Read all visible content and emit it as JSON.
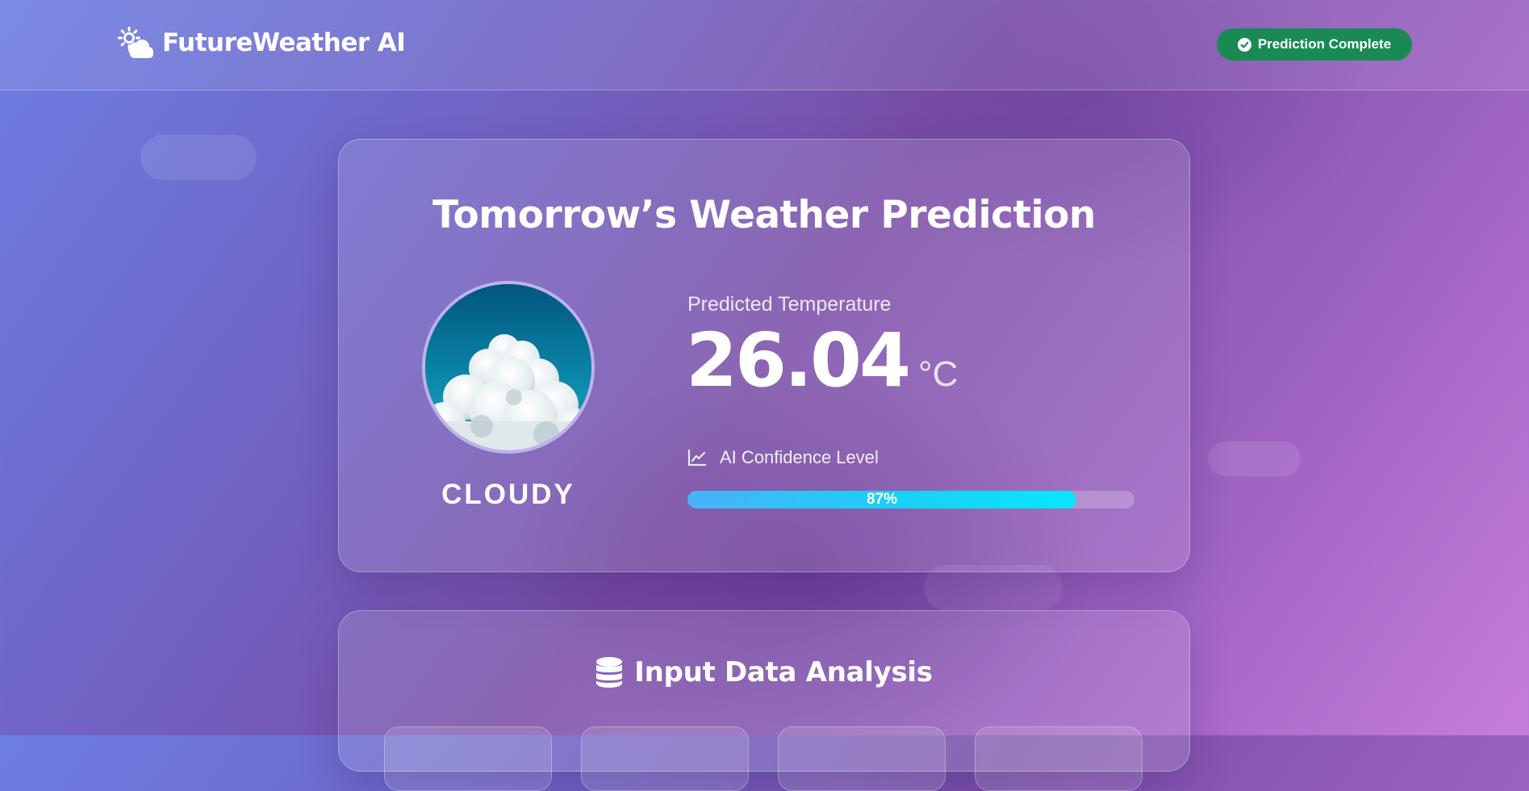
{
  "header": {
    "app_name": "FutureWeather AI",
    "logo_icon": "sun-cloud-icon",
    "status_badge": {
      "label": "Prediction Complete",
      "icon": "check-circle-icon",
      "color": "#1a8a55"
    }
  },
  "prediction": {
    "title": "Tomorrow’s Weather Prediction",
    "condition": "CLOUDY",
    "condition_image": "cloudy-sky-photo",
    "temperature_label": "Predicted Temperature",
    "temperature_value": "26.04",
    "temperature_unit": "°C",
    "confidence_label": "AI Confidence Level",
    "confidence_icon": "line-chart-icon",
    "confidence_fraction": 0.87,
    "confidence_text": "87%"
  },
  "analysis": {
    "title": "Input Data Analysis",
    "icon": "database-icon"
  },
  "colors": {
    "accent_badge": "#1a8a55",
    "progress_start": "#4ab2f7",
    "progress_end": "#08e6f8"
  }
}
